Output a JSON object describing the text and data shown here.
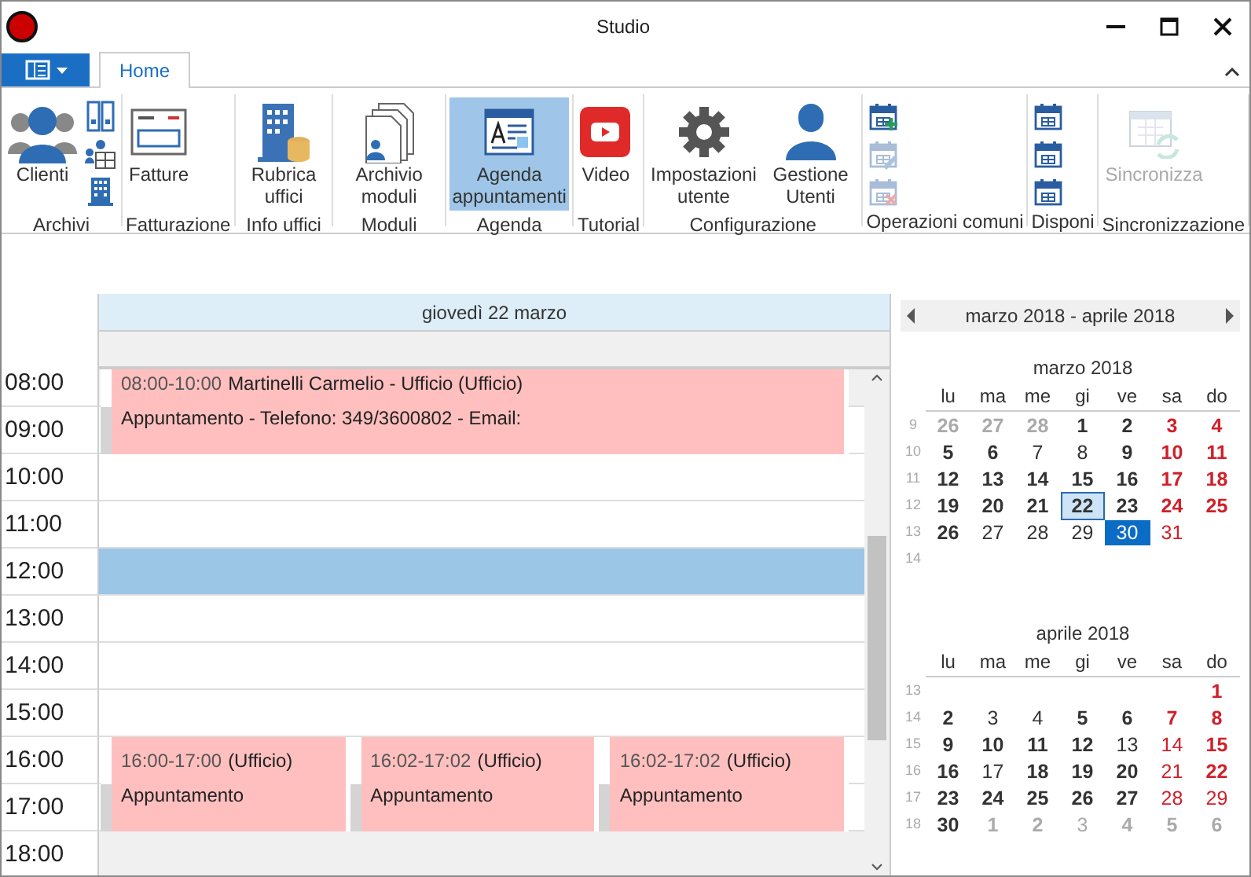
{
  "window": {
    "title": "Studio"
  },
  "tabs": [
    {
      "label": "Home",
      "selected": true
    }
  ],
  "ribbon": [
    {
      "label": "Archivi",
      "buttons": [
        {
          "label": "Clienti",
          "kind": "users",
          "selected": false,
          "disabled": false
        }
      ],
      "small": [
        {
          "kind": "binders",
          "disabled": false
        },
        {
          "kind": "people-grid",
          "disabled": false
        },
        {
          "kind": "building",
          "disabled": false
        }
      ]
    },
    {
      "label": "Fatturazione",
      "buttons": [
        {
          "label": "Fatture",
          "kind": "invoice",
          "selected": false,
          "disabled": false
        }
      ]
    },
    {
      "label": "Info uffici",
      "buttons": [
        {
          "label": "Rubrica uffici",
          "kind": "office",
          "selected": false,
          "disabled": false
        }
      ]
    },
    {
      "label": "Moduli",
      "buttons": [
        {
          "label": "Archivio moduli",
          "kind": "documents",
          "selected": false,
          "disabled": false
        }
      ]
    },
    {
      "label": "Agenda",
      "buttons": [
        {
          "label": "Agenda appuntamenti",
          "kind": "agenda",
          "selected": true,
          "disabled": false
        }
      ]
    },
    {
      "label": "Tutorial",
      "buttons": [
        {
          "label": "Video",
          "kind": "video",
          "selected": false,
          "disabled": false
        }
      ]
    },
    {
      "label": "Configurazione",
      "buttons": [
        {
          "label": "Impostazioni utente",
          "kind": "gear",
          "selected": false,
          "disabled": false
        },
        {
          "label": "Gestione Utenti",
          "kind": "user",
          "selected": false,
          "disabled": false
        }
      ]
    },
    {
      "label": "Operazioni comuni",
      "small": [
        {
          "kind": "cal-add",
          "disabled": false
        },
        {
          "kind": "cal-edit",
          "disabled": true
        },
        {
          "kind": "cal-delete",
          "disabled": true
        }
      ]
    },
    {
      "label": "Disponi",
      "small": [
        {
          "kind": "cal",
          "disabled": false
        },
        {
          "kind": "cal",
          "disabled": false
        },
        {
          "kind": "cal",
          "disabled": false
        }
      ]
    },
    {
      "label": "Sincronizzazione",
      "buttons": [
        {
          "label": "Sincronizza",
          "kind": "sync",
          "selected": false,
          "disabled": true
        }
      ]
    }
  ],
  "day_header": "giovedì 22 marzo",
  "hours": [
    {
      "time": "08:00",
      "shaded": true,
      "selected": false,
      "appointments": [
        {
          "time": "08:00-10:00",
          "title": "Martinelli Carmelio - Ufficio (Ufficio)",
          "body": "Appuntamento - Telefono: 349/3600802 - Email:"
        }
      ]
    },
    {
      "time": "09:00",
      "shaded": false,
      "selected": false
    },
    {
      "time": "10:00",
      "shaded": false,
      "selected": false
    },
    {
      "time": "11:00",
      "shaded": false,
      "selected": false
    },
    {
      "time": "12:00",
      "shaded": false,
      "selected": true
    },
    {
      "time": "13:00",
      "shaded": false,
      "selected": false
    },
    {
      "time": "14:00",
      "shaded": false,
      "selected": false
    },
    {
      "time": "15:00",
      "shaded": false,
      "selected": false
    },
    {
      "time": "16:00",
      "shaded": false,
      "selected": false,
      "appointments": [
        {
          "time": "16:00-17:00",
          "title": "(Ufficio)",
          "body": "Appuntamento"
        },
        {
          "time": "16:02-17:02",
          "title": "(Ufficio)",
          "body": "Appuntamento"
        },
        {
          "time": "16:02-17:02",
          "title": "(Ufficio)",
          "body": "Appuntamento"
        }
      ]
    },
    {
      "time": "17:00",
      "shaded": false,
      "selected": false
    },
    {
      "time": "18:00",
      "shaded": true,
      "selected": false
    }
  ],
  "mini_calendar": {
    "range": "marzo 2018 - aprile 2018",
    "months": [
      {
        "title": "marzo 2018",
        "weekdays": [
          "lu",
          "ma",
          "me",
          "gi",
          "ve",
          "sa",
          "do"
        ],
        "weeks": [
          {
            "week": "9",
            "days": [
              {
                "d": "26",
                "bold": true,
                "muted": true,
                "today": false,
                "selected": false
              },
              {
                "d": "27",
                "bold": true,
                "muted": true,
                "today": false,
                "selected": false
              },
              {
                "d": "28",
                "bold": true,
                "muted": true,
                "today": false,
                "selected": false
              },
              {
                "d": "1",
                "bold": true,
                "muted": false,
                "today": false,
                "selected": false
              },
              {
                "d": "2",
                "bold": true,
                "muted": false,
                "today": false,
                "selected": false
              },
              {
                "d": "3",
                "bold": true,
                "muted": false,
                "today": false,
                "selected": false
              },
              {
                "d": "4",
                "bold": true,
                "muted": false,
                "today": false,
                "selected": false
              }
            ]
          },
          {
            "week": "10",
            "days": [
              {
                "d": "5",
                "bold": true,
                "muted": false,
                "today": false,
                "selected": false
              },
              {
                "d": "6",
                "bold": true,
                "muted": false,
                "today": false,
                "selected": false
              },
              {
                "d": "7",
                "bold": false,
                "muted": false,
                "today": false,
                "selected": false
              },
              {
                "d": "8",
                "bold": false,
                "muted": false,
                "today": false,
                "selected": false
              },
              {
                "d": "9",
                "bold": true,
                "muted": false,
                "today": false,
                "selected": false
              },
              {
                "d": "10",
                "bold": true,
                "muted": false,
                "today": false,
                "selected": false
              },
              {
                "d": "11",
                "bold": true,
                "muted": false,
                "today": false,
                "selected": false
              }
            ]
          },
          {
            "week": "11",
            "days": [
              {
                "d": "12",
                "bold": true,
                "muted": false,
                "today": false,
                "selected": false
              },
              {
                "d": "13",
                "bold": true,
                "muted": false,
                "today": false,
                "selected": false
              },
              {
                "d": "14",
                "bold": true,
                "muted": false,
                "today": false,
                "selected": false
              },
              {
                "d": "15",
                "bold": true,
                "muted": false,
                "today": false,
                "selected": false
              },
              {
                "d": "16",
                "bold": true,
                "muted": false,
                "today": false,
                "selected": false
              },
              {
                "d": "17",
                "bold": true,
                "muted": false,
                "today": false,
                "selected": false
              },
              {
                "d": "18",
                "bold": true,
                "muted": false,
                "today": false,
                "selected": false
              }
            ]
          },
          {
            "week": "12",
            "days": [
              {
                "d": "19",
                "bold": true,
                "muted": false,
                "today": false,
                "selected": false
              },
              {
                "d": "20",
                "bold": true,
                "muted": false,
                "today": false,
                "selected": false
              },
              {
                "d": "21",
                "bold": true,
                "muted": false,
                "today": false,
                "selected": false
              },
              {
                "d": "22",
                "bold": true,
                "muted": false,
                "today": true,
                "selected": false
              },
              {
                "d": "23",
                "bold": true,
                "muted": false,
                "today": false,
                "selected": false
              },
              {
                "d": "24",
                "bold": true,
                "muted": false,
                "today": false,
                "selected": false
              },
              {
                "d": "25",
                "bold": true,
                "muted": false,
                "today": false,
                "selected": false
              }
            ]
          },
          {
            "week": "13",
            "days": [
              {
                "d": "26",
                "bold": true,
                "muted": false,
                "today": false,
                "selected": false
              },
              {
                "d": "27",
                "bold": false,
                "muted": false,
                "today": false,
                "selected": false
              },
              {
                "d": "28",
                "bold": false,
                "muted": false,
                "today": false,
                "selected": false
              },
              {
                "d": "29",
                "bold": false,
                "muted": false,
                "today": false,
                "selected": false
              },
              {
                "d": "30",
                "bold": false,
                "muted": false,
                "today": false,
                "selected": true
              },
              {
                "d": "31",
                "bold": false,
                "muted": false,
                "today": false,
                "selected": false
              }
            ]
          },
          {
            "week": "14"
          }
        ]
      },
      {
        "title": "aprile 2018",
        "weekdays": [
          "lu",
          "ma",
          "me",
          "gi",
          "ve",
          "sa",
          "do"
        ],
        "weeks": [
          {
            "week": "13",
            "days": [
              {
                "d": "1",
                "bold": true,
                "muted": false,
                "today": false,
                "selected": false
              }
            ]
          },
          {
            "week": "14",
            "days": [
              {
                "d": "2",
                "bold": true,
                "muted": false,
                "today": false,
                "selected": false
              },
              {
                "d": "3",
                "bold": false,
                "muted": false,
                "today": false,
                "selected": false
              },
              {
                "d": "4",
                "bold": false,
                "muted": false,
                "today": false,
                "selected": false
              },
              {
                "d": "5",
                "bold": true,
                "muted": false,
                "today": false,
                "selected": false
              },
              {
                "d": "6",
                "bold": true,
                "muted": false,
                "today": false,
                "selected": false
              },
              {
                "d": "7",
                "bold": true,
                "muted": false,
                "today": false,
                "selected": false
              },
              {
                "d": "8",
                "bold": true,
                "muted": false,
                "today": false,
                "selected": false
              }
            ]
          },
          {
            "week": "15",
            "days": [
              {
                "d": "9",
                "bold": true,
                "muted": false,
                "today": false,
                "selected": false
              },
              {
                "d": "10",
                "bold": true,
                "muted": false,
                "today": false,
                "selected": false
              },
              {
                "d": "11",
                "bold": true,
                "muted": false,
                "today": false,
                "selected": false
              },
              {
                "d": "12",
                "bold": true,
                "muted": false,
                "today": false,
                "selected": false
              },
              {
                "d": "13",
                "bold": false,
                "muted": false,
                "today": false,
                "selected": false
              },
              {
                "d": "14",
                "bold": false,
                "muted": false,
                "today": false,
                "selected": false
              },
              {
                "d": "15",
                "bold": true,
                "muted": false,
                "today": false,
                "selected": false
              }
            ]
          },
          {
            "week": "16",
            "days": [
              {
                "d": "16",
                "bold": true,
                "muted": false,
                "today": false,
                "selected": false
              },
              {
                "d": "17",
                "bold": false,
                "muted": false,
                "today": false,
                "selected": false
              },
              {
                "d": "18",
                "bold": true,
                "muted": false,
                "today": false,
                "selected": false
              },
              {
                "d": "19",
                "bold": true,
                "muted": false,
                "today": false,
                "selected": false
              },
              {
                "d": "20",
                "bold": true,
                "muted": false,
                "today": false,
                "selected": false
              },
              {
                "d": "21",
                "bold": false,
                "muted": false,
                "today": false,
                "selected": false
              },
              {
                "d": "22",
                "bold": true,
                "muted": false,
                "today": false,
                "selected": false
              }
            ]
          },
          {
            "week": "17",
            "days": [
              {
                "d": "23",
                "bold": true,
                "muted": false,
                "today": false,
                "selected": false
              },
              {
                "d": "24",
                "bold": true,
                "muted": false,
                "today": false,
                "selected": false
              },
              {
                "d": "25",
                "bold": true,
                "muted": false,
                "today": false,
                "selected": false
              },
              {
                "d": "26",
                "bold": true,
                "muted": false,
                "today": false,
                "selected": false
              },
              {
                "d": "27",
                "bold": true,
                "muted": false,
                "today": false,
                "selected": false
              },
              {
                "d": "28",
                "bold": false,
                "muted": false,
                "today": false,
                "selected": false
              },
              {
                "d": "29",
                "bold": false,
                "muted": false,
                "today": false,
                "selected": false
              }
            ]
          },
          {
            "week": "18",
            "days": [
              {
                "d": "30",
                "bold": true,
                "muted": false,
                "today": false,
                "selected": false
              },
              {
                "d": "1",
                "bold": true,
                "muted": true,
                "today": false,
                "selected": false
              },
              {
                "d": "2",
                "bold": true,
                "muted": true,
                "today": false,
                "selected": false
              },
              {
                "d": "3",
                "bold": false,
                "muted": true,
                "today": false,
                "selected": false
              },
              {
                "d": "4",
                "bold": true,
                "muted": true,
                "today": false,
                "selected": false
              },
              {
                "d": "5",
                "bold": true,
                "muted": true,
                "today": false,
                "selected": false
              },
              {
                "d": "6",
                "bold": true,
                "muted": true,
                "today": false,
                "selected": false
              }
            ]
          }
        ]
      }
    ]
  }
}
